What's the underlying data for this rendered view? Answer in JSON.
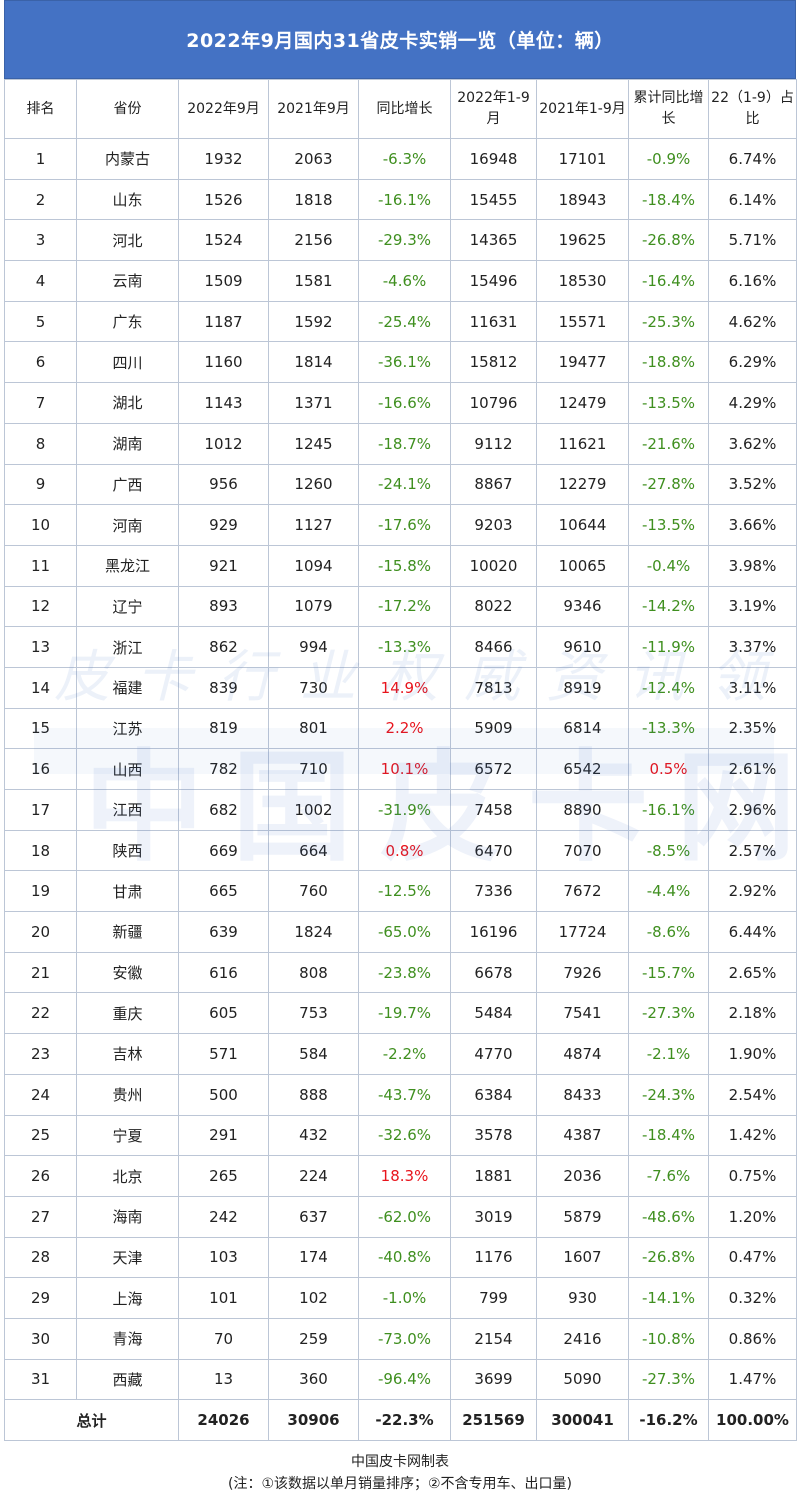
{
  "title": "2022年9月国内31省皮卡实销一览（单位：辆）",
  "headers": [
    "排名",
    "省份",
    "2022年9月",
    "2021年9月",
    "同比增长",
    "2022年1-9月",
    "2021年1-9月",
    "累计同比增长",
    "22（1-9）占比"
  ],
  "rows": [
    [
      "1",
      "内蒙古",
      "1932",
      "2063",
      "-6.3%",
      "16948",
      "17101",
      "-0.9%",
      "6.74%"
    ],
    [
      "2",
      "山东",
      "1526",
      "1818",
      "-16.1%",
      "15455",
      "18943",
      "-18.4%",
      "6.14%"
    ],
    [
      "3",
      "河北",
      "1524",
      "2156",
      "-29.3%",
      "14365",
      "19625",
      "-26.8%",
      "5.71%"
    ],
    [
      "4",
      "云南",
      "1509",
      "1581",
      "-4.6%",
      "15496",
      "18530",
      "-16.4%",
      "6.16%"
    ],
    [
      "5",
      "广东",
      "1187",
      "1592",
      "-25.4%",
      "11631",
      "15571",
      "-25.3%",
      "4.62%"
    ],
    [
      "6",
      "四川",
      "1160",
      "1814",
      "-36.1%",
      "15812",
      "19477",
      "-18.8%",
      "6.29%"
    ],
    [
      "7",
      "湖北",
      "1143",
      "1371",
      "-16.6%",
      "10796",
      "12479",
      "-13.5%",
      "4.29%"
    ],
    [
      "8",
      "湖南",
      "1012",
      "1245",
      "-18.7%",
      "9112",
      "11621",
      "-21.6%",
      "3.62%"
    ],
    [
      "9",
      "广西",
      "956",
      "1260",
      "-24.1%",
      "8867",
      "12279",
      "-27.8%",
      "3.52%"
    ],
    [
      "10",
      "河南",
      "929",
      "1127",
      "-17.6%",
      "9203",
      "10644",
      "-13.5%",
      "3.66%"
    ],
    [
      "11",
      "黑龙江",
      "921",
      "1094",
      "-15.8%",
      "10020",
      "10065",
      "-0.4%",
      "3.98%"
    ],
    [
      "12",
      "辽宁",
      "893",
      "1079",
      "-17.2%",
      "8022",
      "9346",
      "-14.2%",
      "3.19%"
    ],
    [
      "13",
      "浙江",
      "862",
      "994",
      "-13.3%",
      "8466",
      "9610",
      "-11.9%",
      "3.37%"
    ],
    [
      "14",
      "福建",
      "839",
      "730",
      "14.9%",
      "7813",
      "8919",
      "-12.4%",
      "3.11%"
    ],
    [
      "15",
      "江苏",
      "819",
      "801",
      "2.2%",
      "5909",
      "6814",
      "-13.3%",
      "2.35%"
    ],
    [
      "16",
      "山西",
      "782",
      "710",
      "10.1%",
      "6572",
      "6542",
      "0.5%",
      "2.61%"
    ],
    [
      "17",
      "江西",
      "682",
      "1002",
      "-31.9%",
      "7458",
      "8890",
      "-16.1%",
      "2.96%"
    ],
    [
      "18",
      "陕西",
      "669",
      "664",
      "0.8%",
      "6470",
      "7070",
      "-8.5%",
      "2.57%"
    ],
    [
      "19",
      "甘肃",
      "665",
      "760",
      "-12.5%",
      "7336",
      "7672",
      "-4.4%",
      "2.92%"
    ],
    [
      "20",
      "新疆",
      "639",
      "1824",
      "-65.0%",
      "16196",
      "17724",
      "-8.6%",
      "6.44%"
    ],
    [
      "21",
      "安徽",
      "616",
      "808",
      "-23.8%",
      "6678",
      "7926",
      "-15.7%",
      "2.65%"
    ],
    [
      "22",
      "重庆",
      "605",
      "753",
      "-19.7%",
      "5484",
      "7541",
      "-27.3%",
      "2.18%"
    ],
    [
      "23",
      "吉林",
      "571",
      "584",
      "-2.2%",
      "4770",
      "4874",
      "-2.1%",
      "1.90%"
    ],
    [
      "24",
      "贵州",
      "500",
      "888",
      "-43.7%",
      "6384",
      "8433",
      "-24.3%",
      "2.54%"
    ],
    [
      "25",
      "宁夏",
      "291",
      "432",
      "-32.6%",
      "3578",
      "4387",
      "-18.4%",
      "1.42%"
    ],
    [
      "26",
      "北京",
      "265",
      "224",
      "18.3%",
      "1881",
      "2036",
      "-7.6%",
      "0.75%"
    ],
    [
      "27",
      "海南",
      "242",
      "637",
      "-62.0%",
      "3019",
      "5879",
      "-48.6%",
      "1.20%"
    ],
    [
      "28",
      "天津",
      "103",
      "174",
      "-40.8%",
      "1176",
      "1607",
      "-26.8%",
      "0.47%"
    ],
    [
      "29",
      "上海",
      "101",
      "102",
      "-1.0%",
      "799",
      "930",
      "-14.1%",
      "0.32%"
    ],
    [
      "30",
      "青海",
      "70",
      "259",
      "-73.0%",
      "2154",
      "2416",
      "-10.8%",
      "0.86%"
    ],
    [
      "31",
      "西藏",
      "13",
      "360",
      "-96.4%",
      "3699",
      "5090",
      "-27.3%",
      "1.47%"
    ]
  ],
  "total": {
    "label": "总计",
    "values": [
      "24026",
      "30906",
      "-22.3%",
      "251569",
      "300041",
      "-16.2%",
      "100.00%"
    ]
  },
  "watermark": {
    "small": "皮卡行业权威资讯领导者",
    "big": "中国皮卡网"
  },
  "footer": {
    "line1": "中国皮卡网制表",
    "line2": "(注：①该数据以单月销量排序；②不含专用车、出口量)"
  },
  "colors": {
    "header_bg": "#4472c4",
    "negative": "#3f8f1f",
    "positive": "#e8141c",
    "border": "#bcc6d6"
  }
}
